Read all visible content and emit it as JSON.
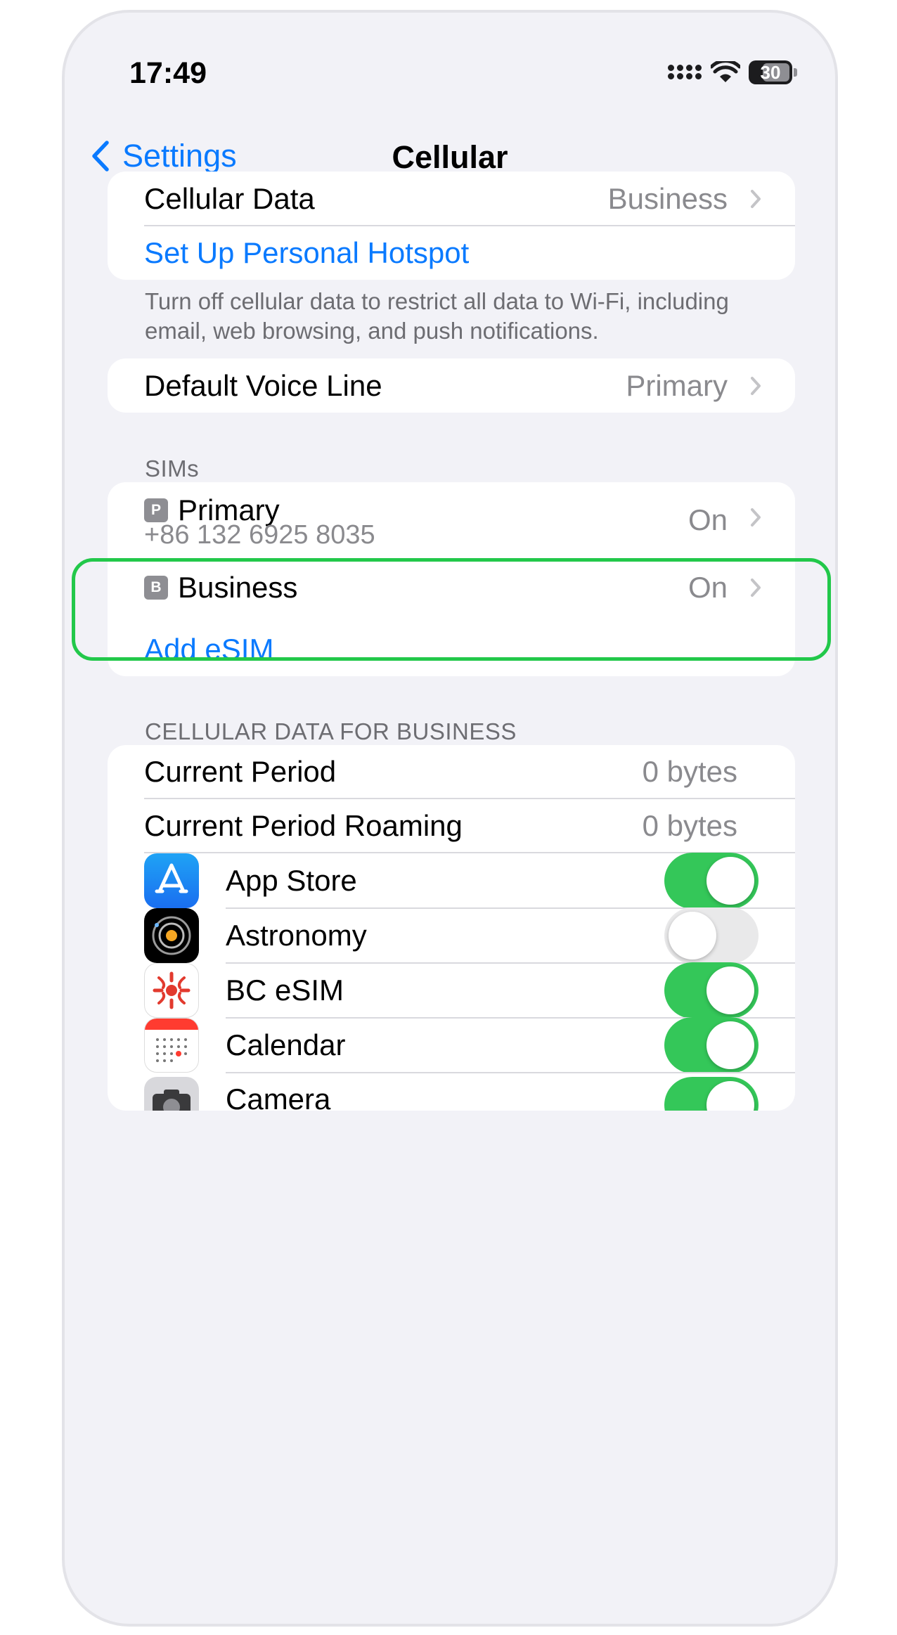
{
  "status_bar": {
    "time": "17:49",
    "battery_level": "30"
  },
  "nav": {
    "back_label": "Settings",
    "title": "Cellular"
  },
  "data_group": {
    "cellular_data": {
      "label": "Cellular Data",
      "value": "Business"
    },
    "hotspot": {
      "label": "Set Up Personal Hotspot"
    },
    "footer": "Turn off cellular data to restrict all data to Wi-Fi, including email, web browsing, and push notifications."
  },
  "voice_group": {
    "label": "Default Voice Line",
    "value": "Primary"
  },
  "sims": {
    "header": "SIMs",
    "items": [
      {
        "badge": "P",
        "name": "Primary",
        "number": "+86 132 6925 8035",
        "status": "On"
      },
      {
        "badge": "B",
        "name": "Business",
        "status": "On"
      }
    ],
    "add_label": "Add eSIM"
  },
  "usage": {
    "header": "CELLULAR DATA FOR BUSINESS",
    "current_period": {
      "label": "Current Period",
      "value": "0 bytes"
    },
    "current_roaming": {
      "label": "Current Period Roaming",
      "value": "0 bytes"
    },
    "apps": [
      {
        "name": "App Store",
        "icon": "app-store-icon",
        "enabled": true
      },
      {
        "name": "Astronomy",
        "icon": "astronomy-icon",
        "enabled": false
      },
      {
        "name": "BC eSIM",
        "icon": "bc-esim-icon",
        "enabled": true
      },
      {
        "name": "Calendar",
        "icon": "calendar-icon",
        "enabled": true
      },
      {
        "name": "Camera",
        "icon": "camera-icon",
        "enabled": true
      }
    ]
  },
  "colors": {
    "accent": "#0a7aff",
    "toggle_on": "#34c759",
    "highlight": "#22c84a"
  }
}
